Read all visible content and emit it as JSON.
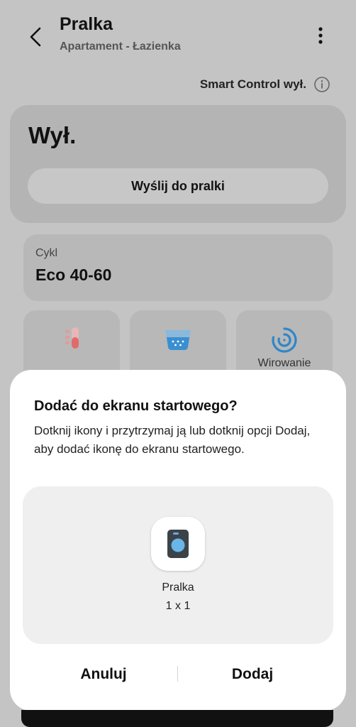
{
  "header": {
    "title": "Pralka",
    "subtitle": "Apartament - Łazienka",
    "back_icon": "chevron-left-icon",
    "more_icon": "more-vertical-icon"
  },
  "smart_control": {
    "label": "Smart Control wył.",
    "icon": "info-icon"
  },
  "status": {
    "state": "Wył.",
    "send_button": "Wyślij do pralki"
  },
  "cycle": {
    "label": "Cykl",
    "value": "Eco 40-60"
  },
  "options": [
    {
      "icon": "temperature-icon",
      "label": ""
    },
    {
      "icon": "rinse-icon",
      "label": ""
    },
    {
      "icon": "spin-icon",
      "label": "Wirowanie"
    }
  ],
  "dialog": {
    "title": "Dodać do ekranu startowego?",
    "description": "Dotknij ikony i przytrzymaj ją lub dotknij opcji Dodaj, aby dodać ikonę do ekranu startowego.",
    "app_name": "Pralka",
    "app_size": "1 x 1",
    "cancel_button": "Anuluj",
    "add_button": "Dodaj"
  },
  "colors": {
    "accent_blue": "#2f86c9",
    "scrim": "#c4c4c4",
    "sheet_bg": "#ffffff"
  }
}
